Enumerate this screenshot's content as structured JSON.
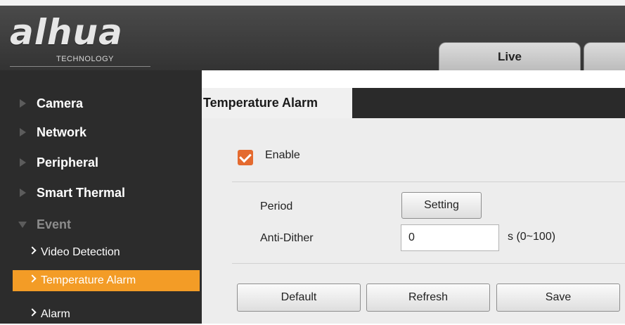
{
  "header": {
    "logo_text": "alhua",
    "logo_sub": "TECHNOLOGY",
    "tabs": [
      {
        "label": "Live"
      },
      {
        "label": ""
      }
    ]
  },
  "sidebar": {
    "items": [
      {
        "label": "Camera",
        "expanded": false
      },
      {
        "label": "Network",
        "expanded": false
      },
      {
        "label": "Peripheral",
        "expanded": false
      },
      {
        "label": "Smart Thermal",
        "expanded": false
      },
      {
        "label": "Event",
        "expanded": true
      }
    ],
    "sub_items": [
      {
        "label": "Video Detection",
        "active": false
      },
      {
        "label": "Temperature Alarm",
        "active": true
      },
      {
        "label": "Alarm",
        "active": false
      }
    ],
    "active_color": "#f39c26"
  },
  "main": {
    "title": "Temperature Alarm",
    "enable": {
      "label": "Enable",
      "checked": true
    },
    "period": {
      "label": "Period",
      "button_label": "Setting"
    },
    "anti_dither": {
      "label": "Anti-Dither",
      "value": "0",
      "unit": "s (0~100)"
    },
    "buttons": {
      "default": "Default",
      "refresh": "Refresh",
      "save": "Save"
    }
  },
  "colors": {
    "accent": "#e46a2f",
    "header": "#3d3d3d",
    "sidebar": "#2c2c2c"
  }
}
